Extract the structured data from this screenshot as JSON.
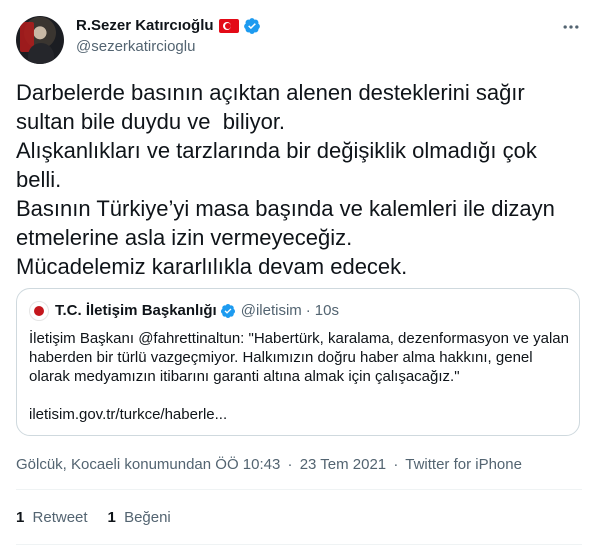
{
  "author": {
    "name": "R.Sezer Katırcıoğlu",
    "handle": "@sezerkatircioglu"
  },
  "tweet": {
    "lines": [
      "Darbelerde basının açıktan alenen desteklerini sağır",
      "sultan bile duydu ve  biliyor.",
      "Alışkanlıkları ve tarzlarında bir değişiklik olmadığı çok",
      "belli.",
      "Basının Türkiye’yi masa başında ve kalemleri ile dizayn",
      "etmelerine asla izin vermeyeceğiz.",
      "Mücadelemiz kararlılıkla devam edecek."
    ]
  },
  "quote": {
    "name": "T.C. İletişim Başkanlığı",
    "handle": "@iletisim",
    "dot": "·",
    "time": "10s",
    "lines": [
      "İletişim Başkanı @fahrettinaltun: \"Habertürk, karalama, dezenformasyon ve yalan",
      "haberden bir türlü vazgeçmiyor. Halkımızın doğru haber alma hakkını, genel",
      "olarak medyamızın itibarını garanti altına almak için çalışacağız.\""
    ],
    "link": "iletisim.gov.tr/turkce/haberle..."
  },
  "meta": {
    "location": "Gölcük, Kocaeli konumundan",
    "time": "ÖÖ 10:43",
    "date": "23 Tem 2021",
    "source": "Twitter for iPhone",
    "separator": "·"
  },
  "stats": {
    "retweets": {
      "count": "1",
      "label": "Retweet"
    },
    "likes": {
      "count": "1",
      "label": "Beğeni"
    }
  },
  "colors": {
    "verified": "#1d9bf0",
    "secondary_text": "#536471",
    "border": "#cfd9de",
    "turkish_flag": "#e30a17"
  },
  "icons": [
    "verified-badge-icon",
    "turkish-flag-icon",
    "more-options-icon"
  ]
}
